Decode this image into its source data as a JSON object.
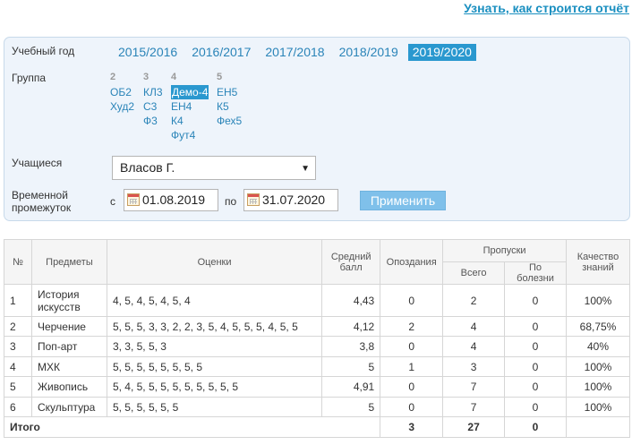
{
  "top_link": "Узнать, как строится отчёт",
  "filters": {
    "year_label": "Учебный год",
    "years": [
      "2015/2016",
      "2016/2017",
      "2017/2018",
      "2018/2019",
      "2019/2020"
    ],
    "active_year": "2019/2020",
    "group_label": "Группа",
    "grades": [
      {
        "grade": "2",
        "groups": [
          "ОБ2",
          "Худ2"
        ]
      },
      {
        "grade": "3",
        "groups": [
          "КЛ3",
          "С3",
          "Ф3"
        ]
      },
      {
        "grade": "4",
        "groups": [
          "Демо-4",
          "ЕН4",
          "К4",
          "Фут4"
        ]
      },
      {
        "grade": "5",
        "groups": [
          "ЕН5",
          "К5",
          "Фех5"
        ]
      }
    ],
    "active_group": "Демо-4",
    "students_label": "Учащиеся",
    "student_value": "Власов Г.",
    "period_label_1": "Временной",
    "period_label_2": "промежуток",
    "from_word": "с",
    "date_from": "01.08.2019",
    "to_word": "по",
    "date_to": "31.07.2020",
    "apply_label": "Применить"
  },
  "table": {
    "headers": {
      "num": "№",
      "subject": "Предметы",
      "marks": "Оценки",
      "avg_1": "Средний",
      "avg_2": "балл",
      "late": "Опоздания",
      "absences": "Пропуски",
      "total": "Всего",
      "sick": "По болезни",
      "quality_1": "Качество",
      "quality_2": "знаний"
    },
    "rows": [
      {
        "num": "1",
        "subject": "История искусств",
        "marks": "4, 5, 4, 5, 4, 5, 4",
        "avg": "4,43",
        "late": "0",
        "total": "2",
        "sick": "0",
        "quality": "100%"
      },
      {
        "num": "2",
        "subject": "Черчение",
        "marks": "5, 5, 5, 3, 3, 2, 2, 3, 5, 4, 5, 5, 5, 4, 5, 5",
        "avg": "4,12",
        "late": "2",
        "total": "4",
        "sick": "0",
        "quality": "68,75%"
      },
      {
        "num": "3",
        "subject": "Поп-арт",
        "marks": "3, 3, 5, 5, 3",
        "avg": "3,8",
        "late": "0",
        "total": "4",
        "sick": "0",
        "quality": "40%"
      },
      {
        "num": "4",
        "subject": "МХК",
        "marks": "5, 5, 5, 5, 5, 5, 5, 5",
        "avg": "5",
        "late": "1",
        "total": "3",
        "sick": "0",
        "quality": "100%"
      },
      {
        "num": "5",
        "subject": "Живопись",
        "marks": "5, 4, 5, 5, 5, 5, 5, 5, 5, 5, 5",
        "avg": "4,91",
        "late": "0",
        "total": "7",
        "sick": "0",
        "quality": "100%"
      },
      {
        "num": "6",
        "subject": "Скульптура",
        "marks": "5, 5, 5, 5, 5, 5",
        "avg": "5",
        "late": "0",
        "total": "7",
        "sick": "0",
        "quality": "100%"
      }
    ],
    "footer": {
      "label": "Итого",
      "late": "3",
      "total": "27",
      "sick": "0"
    }
  }
}
